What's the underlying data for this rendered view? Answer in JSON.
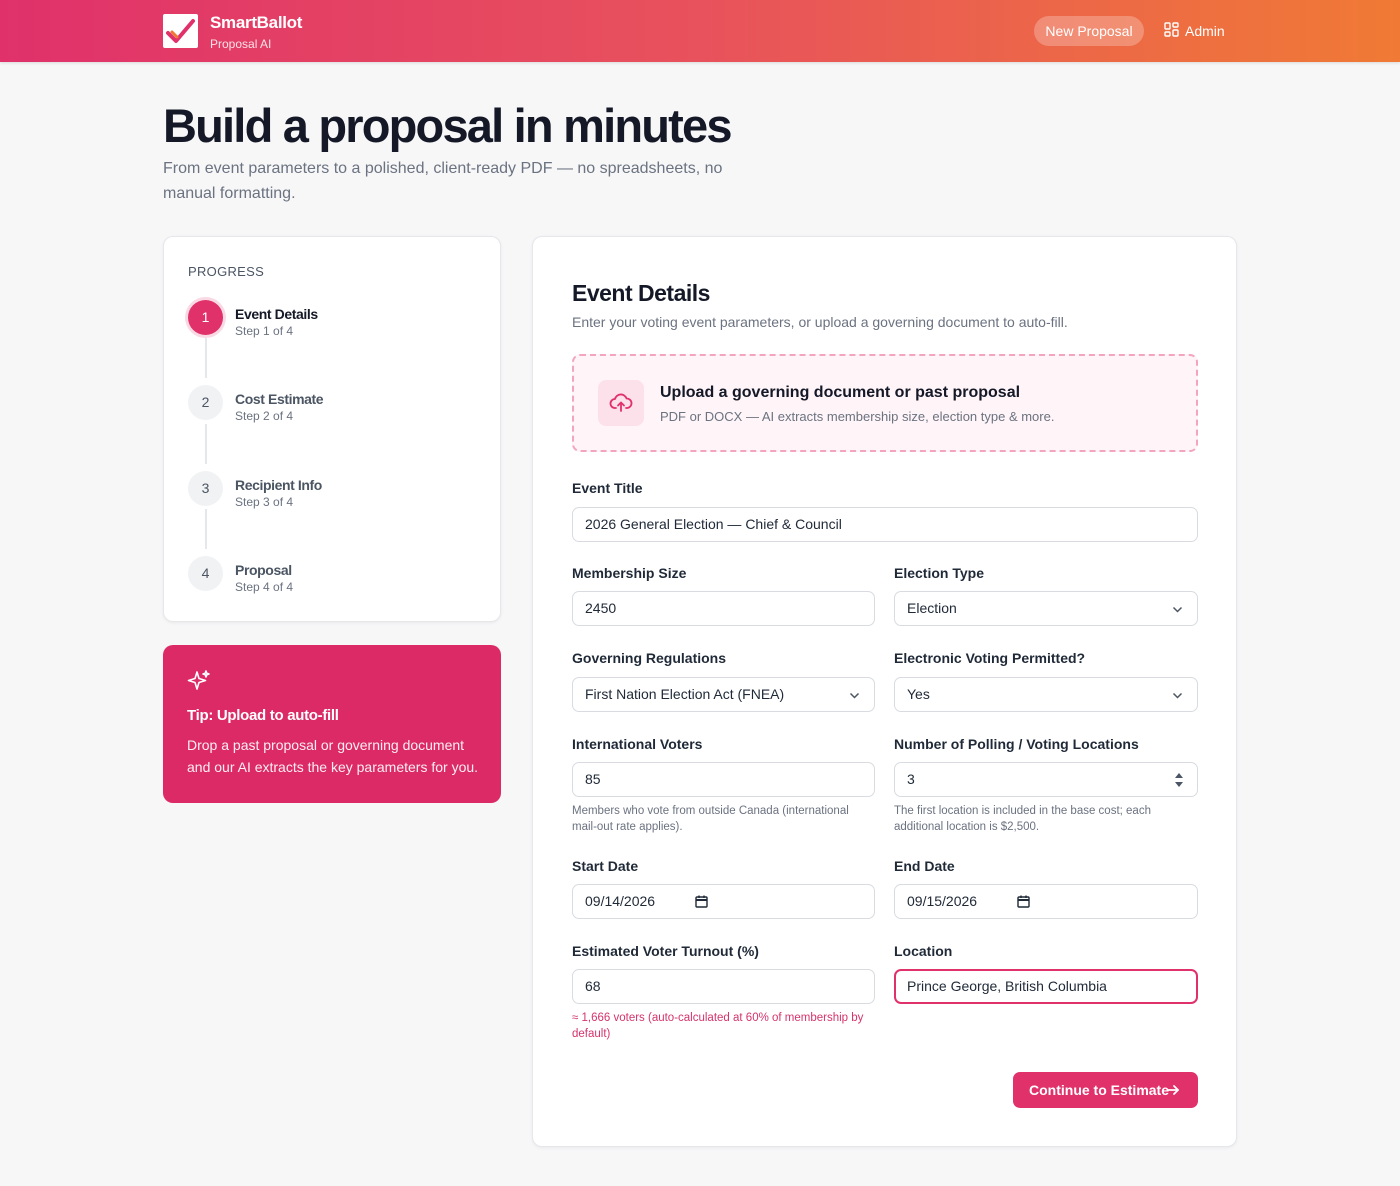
{
  "app": {
    "brand": "SmartBallot",
    "subtitle": "Proposal AI"
  },
  "header": {
    "new_proposal": "New Proposal",
    "admin": "Admin"
  },
  "hero": {
    "title": "Build a proposal in minutes",
    "subtitle": "From event parameters to a polished, client-ready PDF — no spreadsheets, no manual formatting."
  },
  "progress": {
    "label": "PROGRESS",
    "steps": [
      {
        "num": "1",
        "title": "Event Details",
        "sub": "Step 1 of 4"
      },
      {
        "num": "2",
        "title": "Cost Estimate",
        "sub": "Step 2 of 4"
      },
      {
        "num": "3",
        "title": "Recipient Info",
        "sub": "Step 3 of 4"
      },
      {
        "num": "4",
        "title": "Proposal",
        "sub": "Step 4 of 4"
      }
    ]
  },
  "tip": {
    "title": "Tip: Upload to auto-fill",
    "desc": "Drop a past proposal or governing document and our AI extracts the key parameters for you."
  },
  "form": {
    "title": "Event Details",
    "subtitle": "Enter your voting event parameters, or upload a governing document to auto-fill.",
    "upload": {
      "title": "Upload a governing document or past proposal",
      "desc": "PDF or DOCX — AI extracts membership size, election type & more."
    },
    "event_title": {
      "label": "Event Title",
      "value": "2026 General Election — Chief & Council"
    },
    "membership": {
      "label": "Membership Size",
      "value": "2450"
    },
    "election_type": {
      "label": "Election Type",
      "value": "Election"
    },
    "regulations": {
      "label": "Governing Regulations",
      "value": "First Nation Election Act (FNEA)"
    },
    "evoting": {
      "label": "Electronic Voting Permitted?",
      "value": "Yes"
    },
    "intl": {
      "label": "International Voters",
      "value": "85",
      "help": "Members who vote from outside Canada (international mail-out rate applies)."
    },
    "locations": {
      "label": "Number of Polling / Voting Locations",
      "value": "3",
      "help": "The first location is included in the base cost; each additional location is $2,500."
    },
    "start_date": {
      "label": "Start Date",
      "value": "09/14/2026"
    },
    "end_date": {
      "label": "End Date",
      "value": "09/15/2026"
    },
    "turnout": {
      "label": "Estimated Voter Turnout (%)",
      "value": "68",
      "help": "≈ 1,666 voters (auto-calculated at 60% of membership by default)"
    },
    "location": {
      "label": "Location",
      "value": "Prince George, British Columbia"
    },
    "continue": "Continue to Estimate"
  },
  "colors": {
    "accent": "#e0316b",
    "gradient_start": "#e0316b",
    "gradient_end": "#f07a35"
  }
}
